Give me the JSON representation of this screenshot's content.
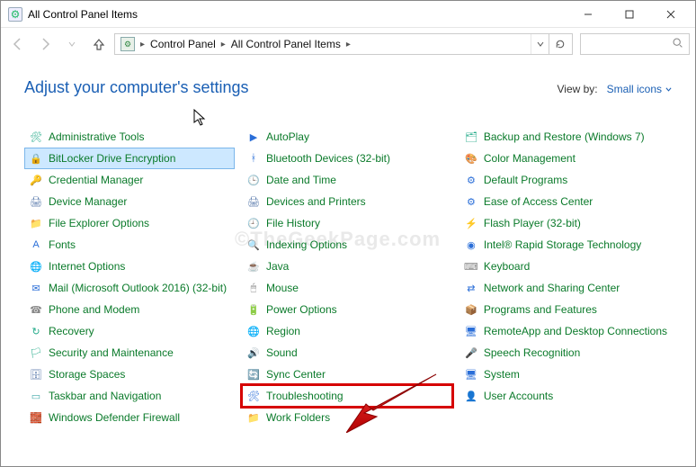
{
  "window": {
    "title": "All Control Panel Items"
  },
  "breadcrumbs": {
    "root": "Control Panel",
    "current": "All Control Panel Items"
  },
  "header": {
    "heading": "Adjust your computer's settings",
    "viewby_label": "View by:",
    "viewby_value": "Small icons"
  },
  "watermark": "©TheGeekPage.com",
  "columns": [
    [
      {
        "id": "administrative-tools",
        "label": "Administrative Tools",
        "icon": "🛠",
        "color": "#2a8"
      },
      {
        "id": "bitlocker-drive-encryption",
        "label": "BitLocker Drive Encryption",
        "icon": "🔒",
        "color": "#c90",
        "selected": true
      },
      {
        "id": "credential-manager",
        "label": "Credential Manager",
        "icon": "🔑",
        "color": "#c90"
      },
      {
        "id": "device-manager",
        "label": "Device Manager",
        "icon": "🖨",
        "color": "#57a"
      },
      {
        "id": "file-explorer-options",
        "label": "File Explorer Options",
        "icon": "📁",
        "color": "#e7a23a"
      },
      {
        "id": "fonts",
        "label": "Fonts",
        "icon": "A",
        "color": "#2a6ed8"
      },
      {
        "id": "internet-options",
        "label": "Internet Options",
        "icon": "🌐",
        "color": "#2a6ed8"
      },
      {
        "id": "mail",
        "label": "Mail (Microsoft Outlook 2016) (32-bit)",
        "icon": "✉",
        "color": "#2a6ed8"
      },
      {
        "id": "phone-and-modem",
        "label": "Phone and Modem",
        "icon": "☎",
        "color": "#888"
      },
      {
        "id": "recovery",
        "label": "Recovery",
        "icon": "↻",
        "color": "#2a8"
      },
      {
        "id": "security-and-maintenance",
        "label": "Security and Maintenance",
        "icon": "🏳",
        "color": "#2a8"
      },
      {
        "id": "storage-spaces",
        "label": "Storage Spaces",
        "icon": "🗄",
        "color": "#57a"
      },
      {
        "id": "taskbar-and-navigation",
        "label": "Taskbar and Navigation",
        "icon": "▭",
        "color": "#4aa"
      },
      {
        "id": "windows-defender-firewall",
        "label": "Windows Defender Firewall",
        "icon": "🧱",
        "color": "#c70"
      }
    ],
    [
      {
        "id": "autoplay",
        "label": "AutoPlay",
        "icon": "▶",
        "color": "#2a6ed8"
      },
      {
        "id": "bluetooth-devices",
        "label": "Bluetooth Devices (32-bit)",
        "icon": "ᚼ",
        "color": "#2a6ed8"
      },
      {
        "id": "date-and-time",
        "label": "Date and Time",
        "icon": "🕒",
        "color": "#2a6ed8"
      },
      {
        "id": "devices-and-printers",
        "label": "Devices and Printers",
        "icon": "🖨",
        "color": "#57a"
      },
      {
        "id": "file-history",
        "label": "File History",
        "icon": "🕘",
        "color": "#2a8"
      },
      {
        "id": "indexing-options",
        "label": "Indexing Options",
        "icon": "🔍",
        "color": "#888"
      },
      {
        "id": "java",
        "label": "Java",
        "icon": "☕",
        "color": "#c70"
      },
      {
        "id": "mouse",
        "label": "Mouse",
        "icon": "🖱",
        "color": "#888"
      },
      {
        "id": "power-options",
        "label": "Power Options",
        "icon": "🔋",
        "color": "#2a8"
      },
      {
        "id": "region",
        "label": "Region",
        "icon": "🌐",
        "color": "#2a6ed8"
      },
      {
        "id": "sound",
        "label": "Sound",
        "icon": "🔊",
        "color": "#888"
      },
      {
        "id": "sync-center",
        "label": "Sync Center",
        "icon": "🔄",
        "color": "#2a8"
      },
      {
        "id": "troubleshooting",
        "label": "Troubleshooting",
        "icon": "🛠",
        "color": "#2a6ed8",
        "highlight": true
      },
      {
        "id": "work-folders",
        "label": "Work Folders",
        "icon": "📁",
        "color": "#e7a23a"
      }
    ],
    [
      {
        "id": "backup-and-restore",
        "label": "Backup and Restore (Windows 7)",
        "icon": "🗂",
        "color": "#2a8"
      },
      {
        "id": "color-management",
        "label": "Color Management",
        "icon": "🎨",
        "color": "#2a6ed8"
      },
      {
        "id": "default-programs",
        "label": "Default Programs",
        "icon": "⚙",
        "color": "#2a6ed8"
      },
      {
        "id": "ease-of-access-center",
        "label": "Ease of Access Center",
        "icon": "⚙",
        "color": "#2a6ed8"
      },
      {
        "id": "flash-player",
        "label": "Flash Player (32-bit)",
        "icon": "⚡",
        "color": "#c00"
      },
      {
        "id": "intel-rapid-storage",
        "label": "Intel® Rapid Storage Technology",
        "icon": "◉",
        "color": "#2a6ed8"
      },
      {
        "id": "keyboard",
        "label": "Keyboard",
        "icon": "⌨",
        "color": "#888"
      },
      {
        "id": "network-and-sharing-center",
        "label": "Network and Sharing Center",
        "icon": "⇄",
        "color": "#2a6ed8"
      },
      {
        "id": "programs-and-features",
        "label": "Programs and Features",
        "icon": "📦",
        "color": "#c90"
      },
      {
        "id": "remoteapp",
        "label": "RemoteApp and Desktop Connections",
        "icon": "🖥",
        "color": "#2a6ed8"
      },
      {
        "id": "speech-recognition",
        "label": "Speech Recognition",
        "icon": "🎤",
        "color": "#888"
      },
      {
        "id": "system",
        "label": "System",
        "icon": "🖥",
        "color": "#2a6ed8"
      },
      {
        "id": "user-accounts",
        "label": "User Accounts",
        "icon": "👤",
        "color": "#2a8"
      }
    ]
  ]
}
